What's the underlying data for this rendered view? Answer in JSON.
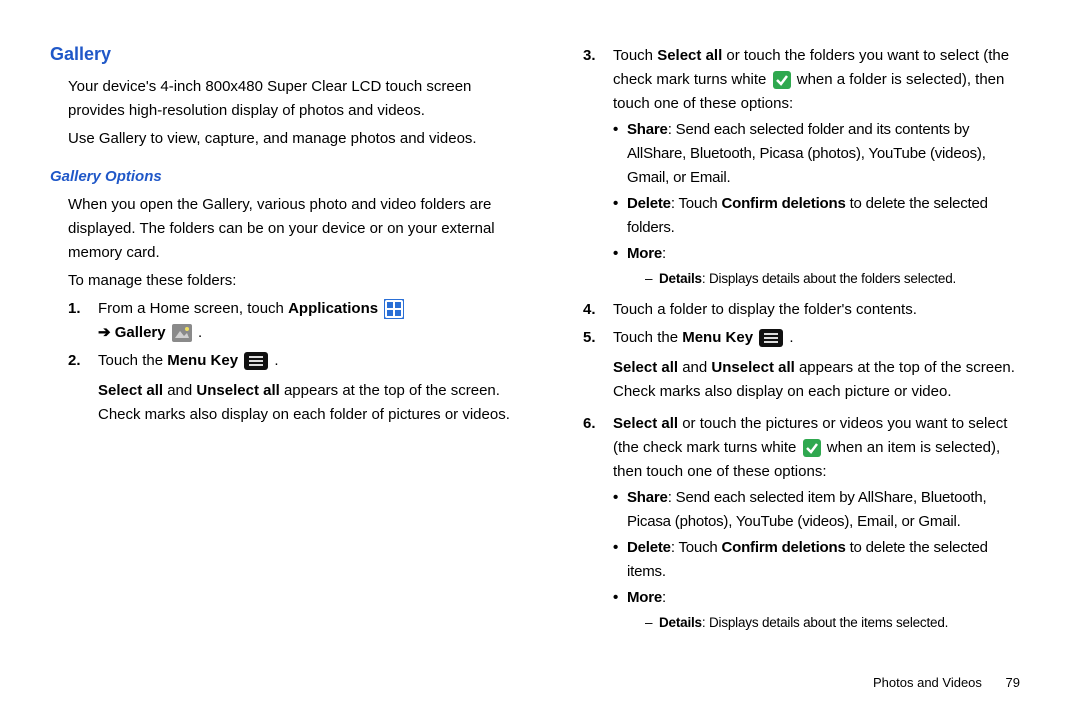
{
  "left": {
    "h1": "Gallery",
    "p1": "Your device's 4-inch 800x480 Super Clear LCD touch screen provides high-resolution display of photos and videos.",
    "p2": "Use Gallery to view, capture, and manage photos and videos.",
    "h2": "Gallery Options",
    "p3": "When you open the Gallery, various photo and video folders are displayed. The folders can be on your device or on your external memory card.",
    "p4": "To manage these folders:",
    "li1_a": "From a Home screen, touch ",
    "li1_apps": "Applications",
    "li1_arrow": "➔ ",
    "li1_gal": "Gallery",
    "li1_period": " .",
    "li2_a": "Touch the ",
    "li2_mk": "Menu Key",
    "li2_b": " .",
    "li2_p1a": "Select all",
    "li2_p1b": " and ",
    "li2_p1c": "Unselect all",
    "li2_p1d": " appears at the top of the screen. Check marks also display on each folder of pictures or videos."
  },
  "right": {
    "li3_a": "Touch ",
    "li3_sa": "Select all",
    "li3_b": " or touch the folders you want to select (the check mark turns white ",
    "li3_c": " when a folder is selected), then touch one of these options:",
    "b3_share_l": "Share",
    "b3_share_t": ": Send each selected folder and its contents by AllShare, Bluetooth, Picasa (photos), YouTube (videos), Gmail, or Email.",
    "b3_del_l": "Delete",
    "b3_del_t1": ": Touch ",
    "b3_del_cd": "Confirm deletions",
    "b3_del_t2": " to delete the selected folders.",
    "b3_more_l": "More",
    "b3_more_c": ":",
    "d3_det_l": "Details",
    "d3_det_t": ": Displays details about the folders selected.",
    "li4": "Touch a folder to display the folder's contents.",
    "li5_a": "Touch the ",
    "li5_mk": "Menu Key",
    "li5_b": " .",
    "li5_p1a": "Select all",
    "li5_p1b": " and ",
    "li5_p1c": "Unselect all",
    "li5_p1d": " appears at the top of the screen. Check marks also display on each picture or video.",
    "li6_sa": "Select all",
    "li6_a": " or touch the pictures or videos you want to select (the check mark turns white ",
    "li6_b": " when an item is selected), then touch one of these options:",
    "b6_share_l": "Share",
    "b6_share_t": ": Send each selected item by AllShare, Bluetooth, Picasa (photos), YouTube (videos), Email, or Gmail.",
    "b6_del_l": "Delete",
    "b6_del_t1": ": Touch ",
    "b6_del_cd": "Confirm deletions",
    "b6_del_t2": " to delete the selected items.",
    "b6_more_l": "More",
    "b6_more_c": ":",
    "d6_det_l": "Details",
    "d6_det_t": ": Displays details about the items selected."
  },
  "footer": {
    "section": "Photos and Videos",
    "page": "79"
  },
  "nums": {
    "n1": "1.",
    "n2": "2.",
    "n3": "3.",
    "n4": "4.",
    "n5": "5.",
    "n6": "6."
  }
}
